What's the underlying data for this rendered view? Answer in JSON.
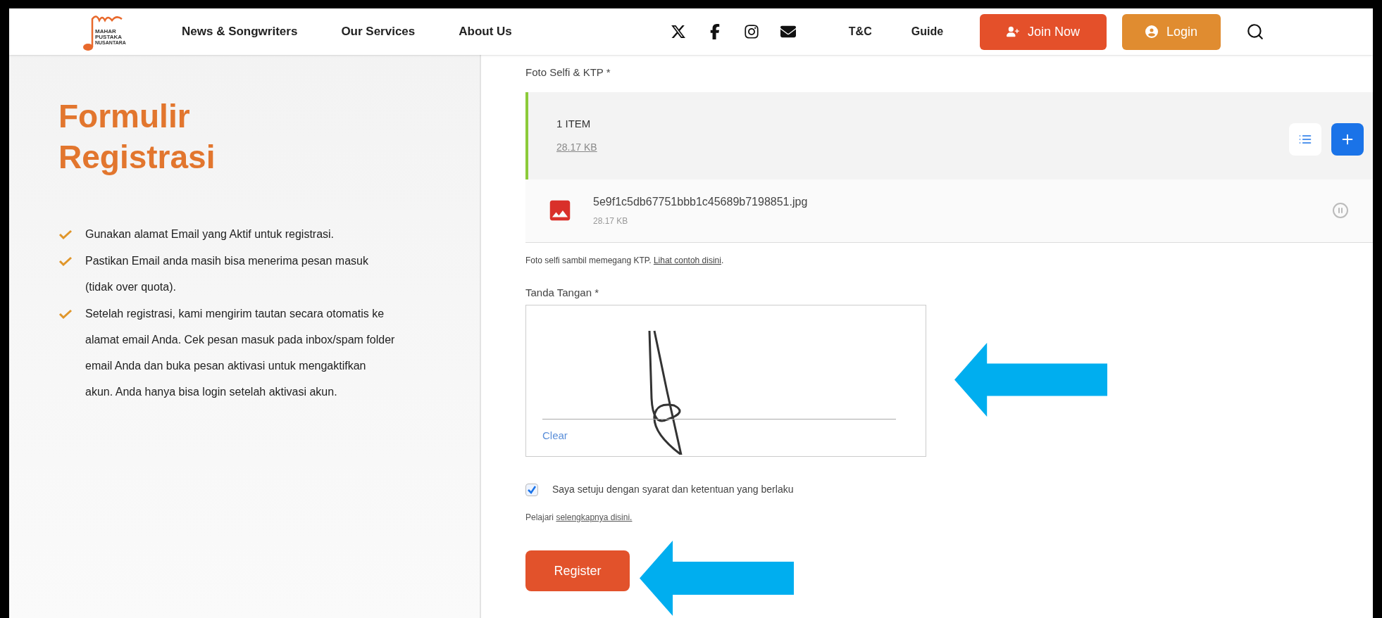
{
  "header": {
    "logo": {
      "lines": [
        "MAHAR",
        "PUSTAKA",
        "NUSANTARA"
      ]
    },
    "nav": [
      "News & Songwriters",
      "Our Services",
      "About Us"
    ],
    "links": [
      "T&C",
      "Guide"
    ],
    "join_button": "Join Now",
    "login_button": "Login"
  },
  "intro": {
    "title_lines": [
      "Formulir",
      "Registrasi"
    ],
    "bullets": [
      "Gunakan alamat Email yang Aktif untuk registrasi.",
      "Pastikan Email anda masih bisa menerima pesan masuk (tidak over quota).",
      "Setelah registrasi, kami mengirim tautan secara otomatis ke alamat email Anda. Cek pesan masuk pada inbox/spam folder email Anda dan buka pesan aktivasi untuk mengaktifkan akun. Anda hanya bisa login setelah aktivasi akun."
    ]
  },
  "upload": {
    "label": "Foto Selfi & KTP *",
    "count": "1 ITEM",
    "total_size": "28.17 KB",
    "files": [
      {
        "name": "5e9f1c5db67751bbb1c45689b7198851.jpg",
        "size": "28.17 KB"
      }
    ],
    "help": "Foto selfi sambil memegang KTP.",
    "help_link": "Lihat contoh disini",
    "help_end": "."
  },
  "signature": {
    "label": "Tanda Tangan *",
    "clear": "Clear"
  },
  "agree": {
    "label": "Saya setuju dengan syarat dan ketentuan yang berlaku",
    "checked": true
  },
  "learn": {
    "text": "Pelajari",
    "link": "selengkapnya disini."
  },
  "register_button": "Register"
}
